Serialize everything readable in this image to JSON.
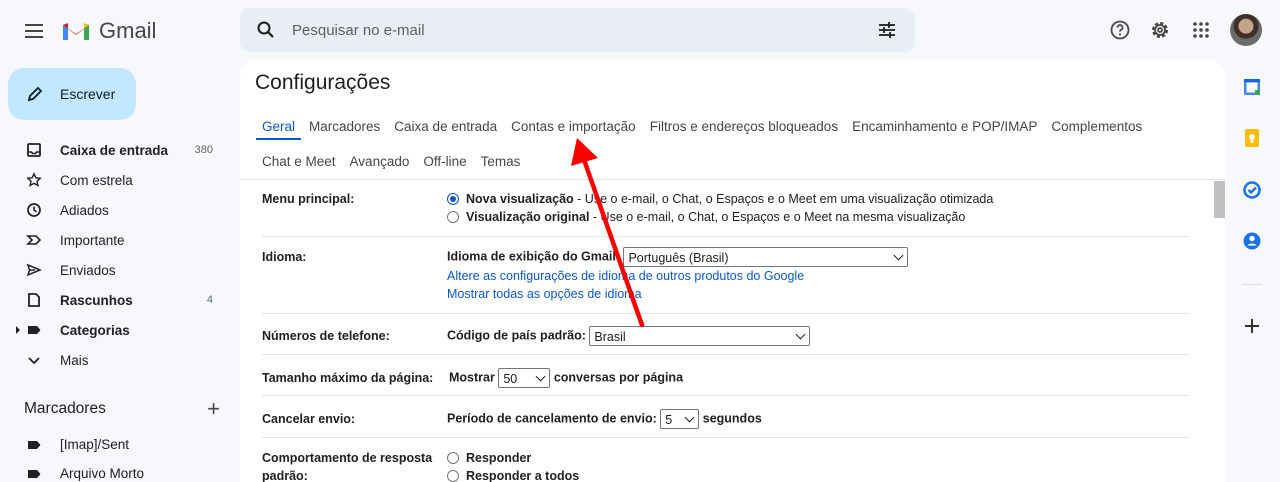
{
  "app": {
    "name": "Gmail"
  },
  "search": {
    "placeholder": "Pesquisar no e-mail"
  },
  "compose": {
    "label": "Escrever"
  },
  "nav": [
    {
      "label": "Caixa de entrada",
      "count": "380",
      "icon": "inbox-icon",
      "bold": true
    },
    {
      "label": "Com estrela",
      "count": "",
      "icon": "star-icon",
      "bold": false
    },
    {
      "label": "Adiados",
      "count": "",
      "icon": "clock-icon",
      "bold": false
    },
    {
      "label": "Importante",
      "count": "",
      "icon": "important-icon",
      "bold": false
    },
    {
      "label": "Enviados",
      "count": "",
      "icon": "send-icon",
      "bold": false
    },
    {
      "label": "Rascunhos",
      "count": "4",
      "icon": "draft-icon",
      "bold": true
    },
    {
      "label": "Categorias",
      "count": "",
      "icon": "label-icon",
      "bold": true
    },
    {
      "label": "Mais",
      "count": "",
      "icon": "chevron-down-icon",
      "bold": false
    }
  ],
  "labels": {
    "title": "Marcadores",
    "items": [
      {
        "label": "[Imap]/Sent"
      },
      {
        "label": "Arquivo Morto"
      }
    ]
  },
  "settings": {
    "title": "Configurações",
    "tabs_row1": [
      "Geral",
      "Marcadores",
      "Caixa de entrada",
      "Contas e importação",
      "Filtros e endereços bloqueados",
      "Encaminhamento e POP/IMAP",
      "Complementos"
    ],
    "tabs_row2": [
      "Chat e Meet",
      "Avançado",
      "Off-line",
      "Temas"
    ],
    "active_tab": "Geral",
    "menu_principal": {
      "label": "Menu principal:",
      "opt1_bold": "Nova visualização",
      "opt1_rest": " - Use o e-mail, o Chat, o Espaços e o Meet em uma visualização otimizada",
      "opt2_bold": "Visualização original",
      "opt2_rest": " - Use o e-mail, o Chat, o Espaços e o Meet na mesma visualização"
    },
    "idioma": {
      "label": "Idioma:",
      "display_label": "Idioma de exibição do Gmail:",
      "value": "Português (Brasil)",
      "link1": "Altere as configurações de idioma de outros produtos do Google",
      "link2": "Mostrar todas as opções de idioma"
    },
    "telefone": {
      "label": "Números de telefone:",
      "field_label": "Código de país padrão:",
      "value": "Brasil"
    },
    "pagina": {
      "label": "Tamanho máximo da página:",
      "prefix": "Mostrar",
      "value": "50",
      "suffix": "conversas por página"
    },
    "cancelar": {
      "label": "Cancelar envio:",
      "prefix": "Período de cancelamento de envio:",
      "value": "5",
      "suffix": "segundos"
    },
    "resposta": {
      "label_line1": "Comportamento de resposta",
      "label_line2": "padrão:",
      "opt1": "Responder",
      "opt2": "Responder a todos"
    }
  },
  "colors": {
    "accent": "#0b57d0",
    "compose_bg": "#c2e7ff",
    "annotation": "#ff0000"
  }
}
